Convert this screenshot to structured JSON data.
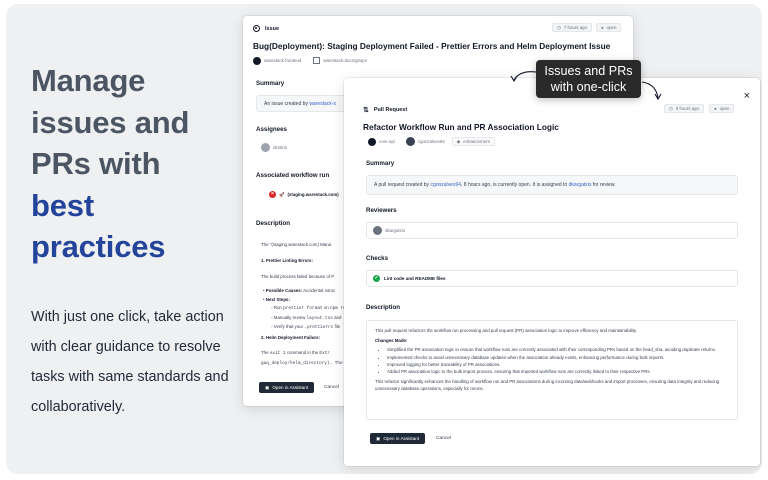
{
  "hero": {
    "line1": "Manage",
    "line2": "issues and",
    "line3": "PRs with",
    "line4": "best",
    "line5": "practices",
    "subtitle": "With just one click, take action with clear guidance to resolve tasks with same standards and collaboratively."
  },
  "callout": {
    "line1": "Issues and PRs",
    "line2": "with one-click"
  },
  "colors": {
    "accent": "#23449a",
    "callout_bg": "#2a2a2a",
    "check_green": "#16a34a",
    "error_red": "#dc2626"
  },
  "issue": {
    "type_label": "Issue",
    "time_badge": "7 hours ago",
    "status_badge": "open",
    "title": "Bug(Deployment): Staging Deployment Failed - Prettier Errors and Helm Deployment Issue",
    "repo": "warestack-frontend",
    "org": "warestack-docs/gitops",
    "summary_heading": "Summary",
    "summary_prefix": "An issue created by",
    "summary_user": "warestack-s",
    "assignees_heading": "Assignees",
    "assignee": "dimitris",
    "workflow_heading": "Associated workflow run",
    "workflow_item": "(staging.warestack.com)",
    "description_heading": "Description",
    "desc_intro": "The \"(staging.warestack.com) Mana",
    "desc_h1": "1. Prettier Linting Errors:",
    "desc_p1": "The build process failed because of P",
    "desc_b1_label": "Possible Causes:",
    "desc_b1": "Accidental introc",
    "desc_b2_label": "Next Steps:",
    "desc_b3": "Run",
    "desc_b3_code": "prettier format",
    "desc_b3_rest": "on",
    "desc_b3_code2": "npm run",
    "desc_b4": "Manually review",
    "desc_b4_code": "layout.tsx",
    "desc_b4_rest": "and",
    "desc_b5": "Verify that your",
    "desc_b5_code": ".prettierrc",
    "desc_b5_rest": "file",
    "desc_h2": "2. Helm Deployment Failure:",
    "desc_p2a_prefix": "The",
    "desc_p2a_code": "exit 1",
    "desc_p2a_rest": "command in the",
    "desc_p2a_code2": "Extr",
    "desc_p2b": "gaq_deploy/helm_directory). The script",
    "open_button": "Open in Assistant",
    "cancel": "Cancel"
  },
  "pr": {
    "type_label": "Pull Request",
    "time_badge": "9 hours ago",
    "status_badge": "open",
    "title": "Refactor Workflow Run and PR Association Logic",
    "repo": "core-api",
    "author": "cgonzalves94",
    "label": "enhancement",
    "summary_heading": "Summary",
    "summary_prefix": "A pull request created by",
    "summary_author": "cgonzalves94",
    "summary_middle": ", 8 hours ago, is currently open. It is assigned to",
    "summary_assignee": "dkargatzis",
    "summary_suffix": "for review.",
    "reviewers_heading": "Reviewers",
    "reviewer": "dkargatzis",
    "checks_heading": "Checks",
    "check_item": "Lint code and README files",
    "description_heading": "Description",
    "desc_intro": "This pull request refactors the workflow run processing and pull request (PR) association logic to improve efficiency and maintainability.",
    "changes_label": "Changes Made:",
    "changes": [
      "Simplified the PR association logic to ensure that workflow runs are correctly associated with their corresponding PRs based on the head_sha, avoiding duplicate returns.",
      "Implemented checks to avoid unnecessary database updates when the association already exists, enhancing performance during bulk imports.",
      "Improved logging for better traceability of PR associations.",
      "Added PR association logic to the bulk import process, ensuring that imported workflow runs are correctly linked to their respective PRs."
    ],
    "desc_outro": "This refactor significantly enhances the handling of workflow run and PR associations during incoming data/webhooks and import processes, ensuring data integrity and reducing unnecessary database operations, especially for reruns.",
    "open_button": "Open in Assistant",
    "cancel": "Cancel",
    "close_symbol": "×"
  }
}
